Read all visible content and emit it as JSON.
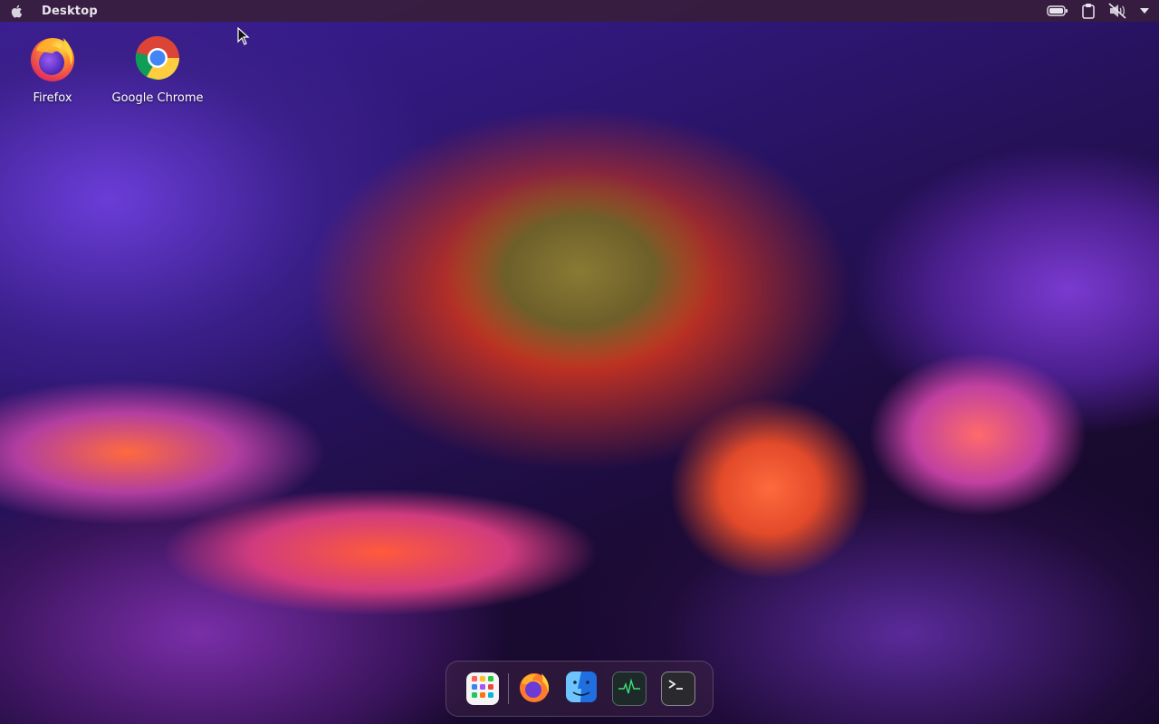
{
  "menubar": {
    "active_app": "Desktop",
    "tray": [
      {
        "name": "battery-icon"
      },
      {
        "name": "clipboard-icon"
      },
      {
        "name": "volume-muted-icon"
      },
      {
        "name": "chevron-down-icon"
      }
    ]
  },
  "desktop": {
    "icons": [
      {
        "label": "Firefox",
        "icon": "firefox-icon"
      },
      {
        "label": "Google Chrome",
        "icon": "chrome-icon"
      }
    ]
  },
  "dock": {
    "items": [
      {
        "icon": "app-launcher-icon"
      },
      {
        "icon": "firefox-icon"
      },
      {
        "icon": "finder-icon"
      },
      {
        "icon": "system-monitor-icon"
      },
      {
        "icon": "terminal-icon"
      }
    ]
  },
  "colors": {
    "menubar": "#371e3c",
    "text": "#e9e4ee"
  }
}
